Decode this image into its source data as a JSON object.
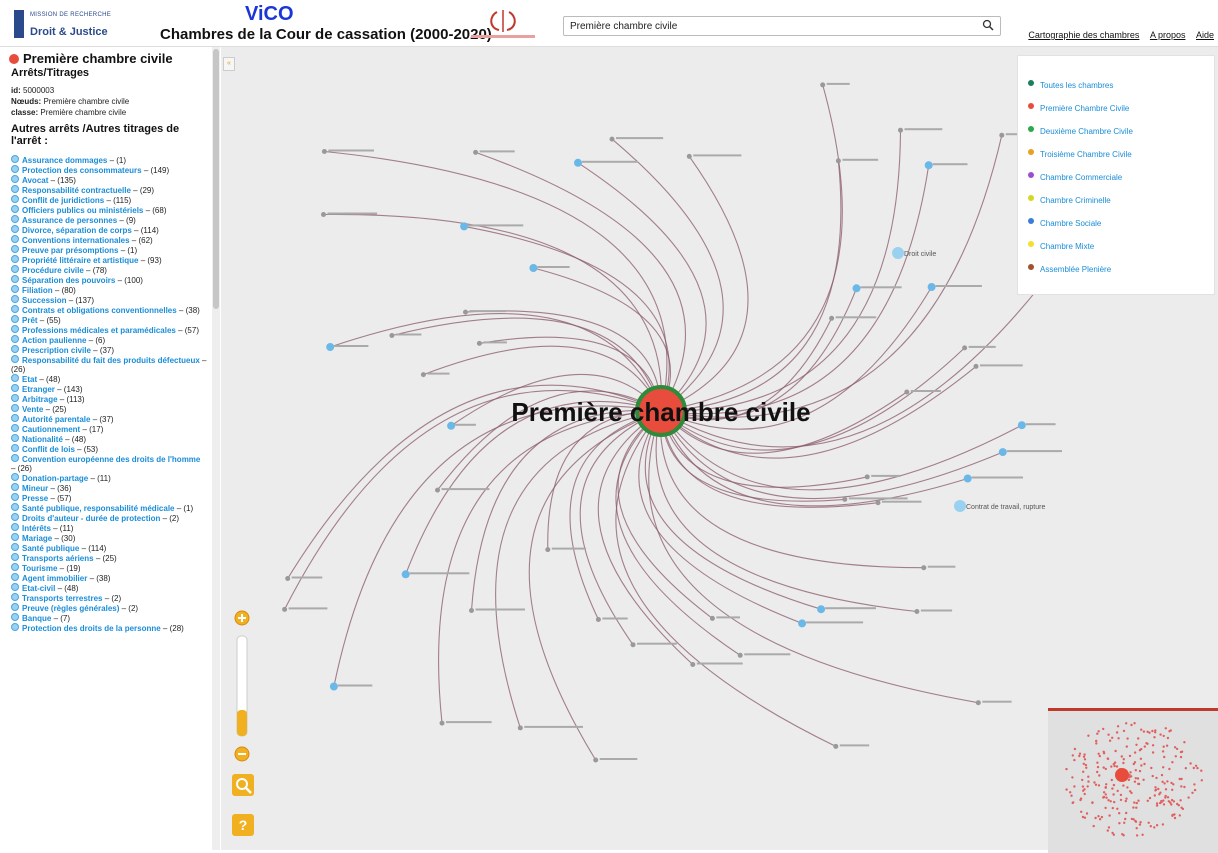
{
  "header": {
    "logo_small": "MISSION DE RECHERCHE",
    "logo_big": "Droit & Justice",
    "app_name": "ViCO",
    "app_title": "Chambres de la Cour de cassation (2000-2020)",
    "search_value": "Première chambre civile",
    "links": [
      "Cartographie des chambres",
      "A propos",
      "Aide"
    ]
  },
  "sidebar": {
    "node_title": "Première chambre civile",
    "section1": "Arrêts/Titrages",
    "id_label": "id:",
    "id_value": "5000003",
    "noeuds_label": "Nœuds:",
    "noeuds_value": "Première chambre civile",
    "classe_label": "classe:",
    "classe_value": "Première chambre civile",
    "section2": "Autres arrêts /Autres titrages de l'arrêt :",
    "items": [
      {
        "label": "Assurance dommages",
        "count": "– (1)"
      },
      {
        "label": "Protection des consommateurs",
        "count": "– (149)"
      },
      {
        "label": "Avocat",
        "count": "– (135)"
      },
      {
        "label": "Responsabilité contractuelle",
        "count": "– (29)"
      },
      {
        "label": "Conflit de juridictions",
        "count": "– (115)"
      },
      {
        "label": "Officiers publics ou ministériels",
        "count": "– (68)"
      },
      {
        "label": "Assurance de personnes",
        "count": "– (9)"
      },
      {
        "label": "Divorce, séparation de corps",
        "count": "– (114)"
      },
      {
        "label": "Conventions internationales",
        "count": "– (62)"
      },
      {
        "label": "Preuve par présomptions",
        "count": "– (1)"
      },
      {
        "label": "Propriété littéraire et artistique",
        "count": "– (93)"
      },
      {
        "label": "Procédure civile",
        "count": "– (78)"
      },
      {
        "label": "Séparation des pouvoirs",
        "count": "– (100)"
      },
      {
        "label": "Filiation",
        "count": "– (80)"
      },
      {
        "label": "Succession",
        "count": "– (137)"
      },
      {
        "label": "Contrats et obligations conventionnelles",
        "count": "– (38)"
      },
      {
        "label": "Prêt",
        "count": "– (55)"
      },
      {
        "label": "Professions médicales et paramédicales",
        "count": "– (57)"
      },
      {
        "label": "Action paulienne",
        "count": "– (6)"
      },
      {
        "label": "Prescription civile",
        "count": "– (37)"
      },
      {
        "label": "Responsabilité du fait des produits défectueux",
        "count": "– (26)"
      },
      {
        "label": "Etat",
        "count": "– (48)"
      },
      {
        "label": "Etranger",
        "count": "– (143)"
      },
      {
        "label": "Arbitrage",
        "count": "– (113)"
      },
      {
        "label": "Vente",
        "count": "– (25)"
      },
      {
        "label": "Autorité parentale",
        "count": "– (37)"
      },
      {
        "label": "Cautionnement",
        "count": "– (17)"
      },
      {
        "label": "Nationalité",
        "count": "– (48)"
      },
      {
        "label": "Conflit de lois",
        "count": "– (53)"
      },
      {
        "label": "Convention européenne des droits de l'homme",
        "count": "– (26)"
      },
      {
        "label": "Donation-partage",
        "count": "– (11)"
      },
      {
        "label": "Mineur",
        "count": "– (36)"
      },
      {
        "label": "Presse",
        "count": "– (57)"
      },
      {
        "label": "Santé publique, responsabilité médicale",
        "count": "– (1)"
      },
      {
        "label": "Droits d'auteur - durée de protection",
        "count": "– (2)"
      },
      {
        "label": "Intérêts",
        "count": "– (11)"
      },
      {
        "label": "Mariage",
        "count": "– (30)"
      },
      {
        "label": "Santé publique",
        "count": "– (114)"
      },
      {
        "label": "Transports aériens",
        "count": "– (25)"
      },
      {
        "label": "Tourisme",
        "count": "– (19)"
      },
      {
        "label": "Agent immobilier",
        "count": "– (38)"
      },
      {
        "label": "Etat-civil",
        "count": "– (48)"
      },
      {
        "label": "Transports terrestres",
        "count": "– (2)"
      },
      {
        "label": "Preuve (règles générales)",
        "count": "– (2)"
      },
      {
        "label": "Banque",
        "count": "– (7)"
      },
      {
        "label": "Protection des droits de la personne",
        "count": "– (28)"
      }
    ]
  },
  "legend": [
    {
      "label": "Toutes les chambres",
      "color": "#1a7f5a"
    },
    {
      "label": "Première Chambre Civile",
      "color": "#e74c3c"
    },
    {
      "label": "Deuxième Chambre Civile",
      "color": "#2ea84a"
    },
    {
      "label": "Troisième Chambre Civile",
      "color": "#e8a11e"
    },
    {
      "label": "Chambre Commerciale",
      "color": "#9b4fd0"
    },
    {
      "label": "Chambre Criminelle",
      "color": "#d4d81e"
    },
    {
      "label": "Chambre Sociale",
      "color": "#3b7dd8"
    },
    {
      "label": "Chambre Mixte",
      "color": "#f2e02a"
    },
    {
      "label": "Assemblée Plenière",
      "color": "#a0522d"
    }
  ],
  "graph": {
    "central_label": "Première chambre civile",
    "label_contrat": "Contrat de travail, rupture",
    "label_droit_civile": "Droit civile"
  },
  "colors": {
    "accent": "#1a8dd8",
    "central_node": "#e74c3c",
    "edge": "#8a5a6a",
    "brand": "#1a35d8"
  }
}
